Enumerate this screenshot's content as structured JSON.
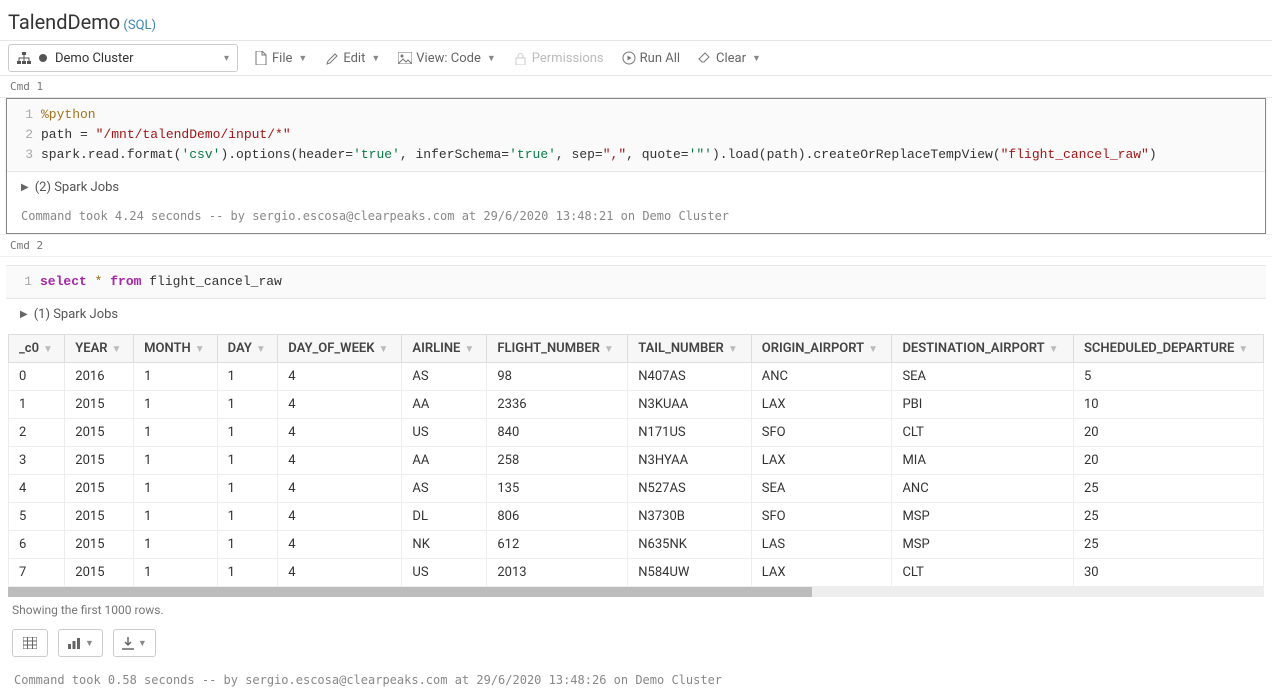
{
  "header": {
    "title": "TalendDemo",
    "lang": "(SQL)"
  },
  "toolbar": {
    "cluster": "Demo Cluster",
    "file": "File",
    "edit": "Edit",
    "view": "View: Code",
    "permissions": "Permissions",
    "run_all": "Run All",
    "clear": "Clear"
  },
  "cmd1": {
    "label": "Cmd 1",
    "lines": {
      "l1": "%python",
      "l2_a": "path = ",
      "l2_b": "\"/mnt/talendDemo/input/*\"",
      "l3_a": "spark.read.format(",
      "l3_b": "'csv'",
      "l3_c": ").options(header=",
      "l3_d": "'true'",
      "l3_e": ", inferSchema=",
      "l3_f": "'true'",
      "l3_g": ", sep=",
      "l3_h": "\",\"",
      "l3_i": ", quote=",
      "l3_j": "'\"'",
      "l3_k": ").load(path).createOrReplaceTempView(",
      "l3_l": "\"flight_cancel_raw\"",
      "l3_m": ")"
    },
    "jobs": "(2) Spark Jobs",
    "status": "Command took 4.24 seconds -- by sergio.escosa@clearpeaks.com at 29/6/2020 13:48:21 on Demo Cluster"
  },
  "cmd2": {
    "label": "Cmd 2",
    "sql": {
      "kw1": "select",
      "star": " * ",
      "kw2": "from",
      "rest": " flight_cancel_raw"
    },
    "jobs": "(1) Spark Jobs",
    "columns": [
      "_c0",
      "YEAR",
      "MONTH",
      "DAY",
      "DAY_OF_WEEK",
      "AIRLINE",
      "FLIGHT_NUMBER",
      "TAIL_NUMBER",
      "ORIGIN_AIRPORT",
      "DESTINATION_AIRPORT",
      "SCHEDULED_DEPARTURE"
    ],
    "rows": [
      [
        "0",
        "2016",
        "1",
        "1",
        "4",
        "AS",
        "98",
        "N407AS",
        "ANC",
        "SEA",
        "5"
      ],
      [
        "1",
        "2015",
        "1",
        "1",
        "4",
        "AA",
        "2336",
        "N3KUAA",
        "LAX",
        "PBI",
        "10"
      ],
      [
        "2",
        "2015",
        "1",
        "1",
        "4",
        "US",
        "840",
        "N171US",
        "SFO",
        "CLT",
        "20"
      ],
      [
        "3",
        "2015",
        "1",
        "1",
        "4",
        "AA",
        "258",
        "N3HYAA",
        "LAX",
        "MIA",
        "20"
      ],
      [
        "4",
        "2015",
        "1",
        "1",
        "4",
        "AS",
        "135",
        "N527AS",
        "SEA",
        "ANC",
        "25"
      ],
      [
        "5",
        "2015",
        "1",
        "1",
        "4",
        "DL",
        "806",
        "N3730B",
        "SFO",
        "MSP",
        "25"
      ],
      [
        "6",
        "2015",
        "1",
        "1",
        "4",
        "NK",
        "612",
        "N635NK",
        "LAS",
        "MSP",
        "25"
      ],
      [
        "7",
        "2015",
        "1",
        "1",
        "4",
        "US",
        "2013",
        "N584UW",
        "LAX",
        "CLT",
        "30"
      ]
    ],
    "rows_note": "Showing the first 1000 rows.",
    "status": "Command took 0.58 seconds -- by sergio.escosa@clearpeaks.com at 29/6/2020 13:48:26 on Demo Cluster"
  }
}
